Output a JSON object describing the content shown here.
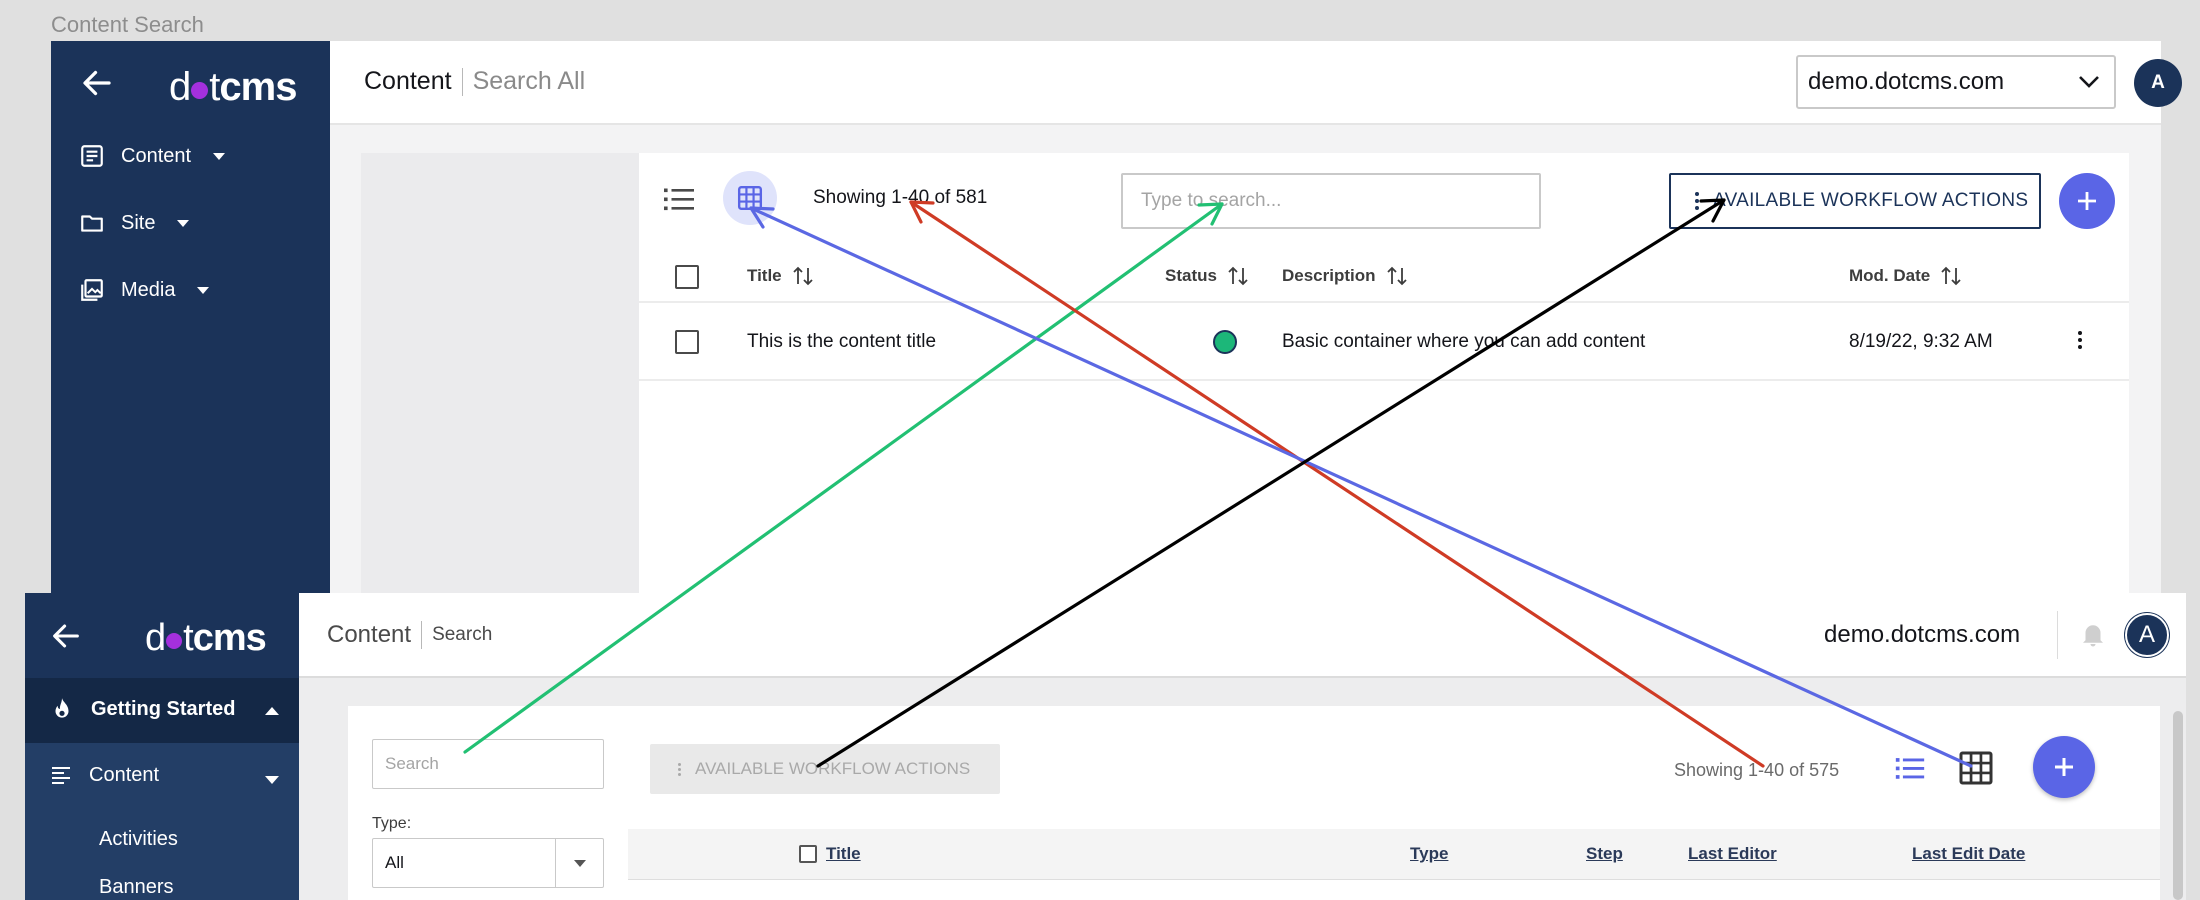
{
  "caption": "Content Search",
  "top": {
    "logo": {
      "prefix": "d",
      "middle": "t",
      "suffix": "cms"
    },
    "nav": [
      {
        "label": "Content"
      },
      {
        "label": "Site"
      },
      {
        "label": "Media"
      }
    ],
    "breadcrumb": {
      "section": "Content",
      "page": "Search All"
    },
    "site": "demo.dotcms.com",
    "avatar": "A",
    "showing": "Showing 1-40 of 581",
    "search_placeholder": "Type to search...",
    "workflow_label": "AVAILABLE WORKFLOW ACTIONS",
    "columns": {
      "title": "Title",
      "status": "Status",
      "description": "Description",
      "mod_date": "Mod. Date"
    },
    "rows": [
      {
        "title": "This is the content title",
        "status": "published",
        "description": "Basic container where you can add content",
        "mod_date": "8/19/22, 9:32 AM"
      }
    ]
  },
  "bottom": {
    "logo": {
      "prefix": "d",
      "middle": "t",
      "suffix": "cms"
    },
    "breadcrumb": {
      "section": "Content",
      "page": "Search"
    },
    "site": "demo.dotcms.com",
    "avatar": "A",
    "nav": {
      "getting_started": "Getting Started",
      "content": "Content",
      "sub": [
        "Activities",
        "Banners"
      ]
    },
    "search_placeholder": "Search",
    "type_label": "Type:",
    "type_value": "All",
    "workflow_label": "AVAILABLE WORKFLOW ACTIONS",
    "showing": "Showing 1-40 of 575",
    "columns": {
      "title": "Title",
      "type": "Type",
      "step": "Step",
      "last_editor": "Last Editor",
      "last_edit_date": "Last Edit Date"
    }
  },
  "colors": {
    "sidebar": "#1b3359",
    "accent": "#5a65e6",
    "status_green": "#1cb779",
    "arrow_green": "#22c073",
    "arrow_red": "#cf3b25",
    "arrow_blue": "#5b68e3",
    "arrow_black": "#000000"
  }
}
